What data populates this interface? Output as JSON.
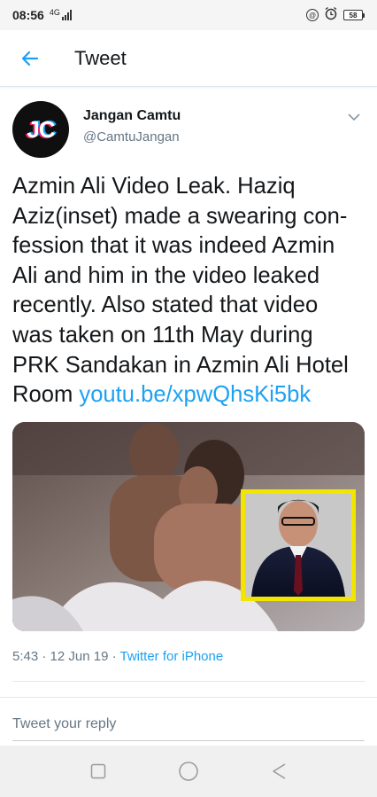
{
  "status_bar": {
    "time": "08:56",
    "network": "4G",
    "battery": "58"
  },
  "header": {
    "title": "Tweet",
    "back_icon": "arrow-left-icon"
  },
  "tweet": {
    "author": {
      "name": "Jangan Camtu",
      "handle": "@CamtuJangan",
      "avatar_text": "JC"
    },
    "text_lines": [
      "Azmin Ali Video Leak. Haziq",
      "Aziz(inset) made a swearing con-",
      "fession that it was indeed Azmin",
      "Ali and him in the video leaked",
      "recently. Also stated that video",
      "was taken on 11th May during",
      "PRK Sandakan in Azmin Ali Hotel",
      "Room"
    ],
    "link": "youtu.be/xpwQhsKi5bk",
    "timestamp": "5:43 · 12 Jun 19 · ",
    "source": "Twitter for iPhone"
  },
  "reply": {
    "placeholder": "Tweet your reply"
  },
  "colors": {
    "accent": "#1da1f2",
    "secondary_text": "#657786",
    "inset_border": "#f2e600"
  }
}
